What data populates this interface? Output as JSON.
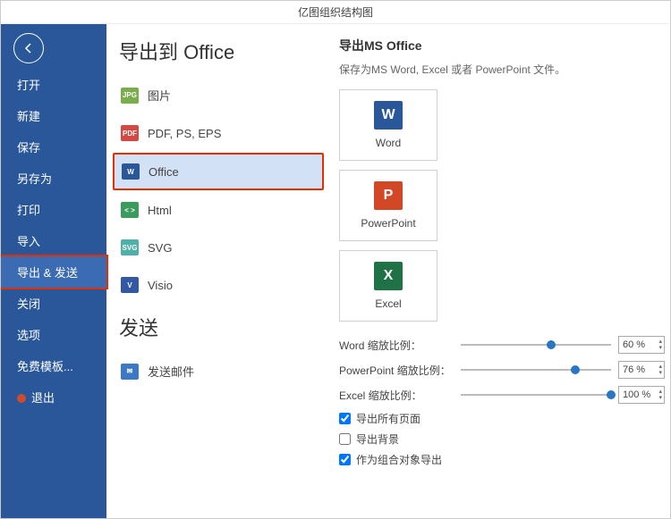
{
  "title": "亿图组织结构图",
  "sidebar": {
    "items": [
      {
        "label": "打开"
      },
      {
        "label": "新建"
      },
      {
        "label": "保存"
      },
      {
        "label": "另存为"
      },
      {
        "label": "打印"
      },
      {
        "label": "导入"
      },
      {
        "label": "导出 & 发送",
        "selected": true,
        "highlighted": true
      },
      {
        "label": "关闭"
      },
      {
        "label": "选项"
      },
      {
        "label": "免费模板..."
      },
      {
        "label": "退出",
        "exit": true
      }
    ]
  },
  "export": {
    "heading": "导出到 Office",
    "items": [
      {
        "label": "图片",
        "icon": "jpg",
        "iconText": "JPG"
      },
      {
        "label": "PDF, PS, EPS",
        "icon": "pdf",
        "iconText": "PDF"
      },
      {
        "label": "Office",
        "icon": "office",
        "iconText": "W",
        "selected": true,
        "highlighted": true
      },
      {
        "label": "Html",
        "icon": "html",
        "iconText": "< >"
      },
      {
        "label": "SVG",
        "icon": "svg",
        "iconText": "SVG"
      },
      {
        "label": "Visio",
        "icon": "visio",
        "iconText": "V"
      }
    ],
    "sendHeading": "发送",
    "sendItems": [
      {
        "label": "发送邮件",
        "icon": "mail",
        "iconText": "✉"
      }
    ]
  },
  "detail": {
    "heading": "导出MS Office",
    "desc": "保存为MS Word, Excel 或者 PowerPoint 文件。",
    "targets": [
      {
        "label": "Word",
        "cls": "word",
        "glyph": "W"
      },
      {
        "label": "PowerPoint",
        "cls": "ppt",
        "glyph": "P"
      },
      {
        "label": "Excel",
        "cls": "excel",
        "glyph": "X"
      }
    ],
    "sliders": [
      {
        "label": "Word 缩放比例：",
        "value": "60 %",
        "pos": 60
      },
      {
        "label": "PowerPoint 缩放比例：",
        "value": "76 %",
        "pos": 76
      },
      {
        "label": "Excel 缩放比例：",
        "value": "100 %",
        "pos": 100
      }
    ],
    "checks": [
      {
        "label": "导出所有页面",
        "checked": true
      },
      {
        "label": "导出背景",
        "checked": false
      },
      {
        "label": "作为组合对象导出",
        "checked": true
      }
    ]
  }
}
